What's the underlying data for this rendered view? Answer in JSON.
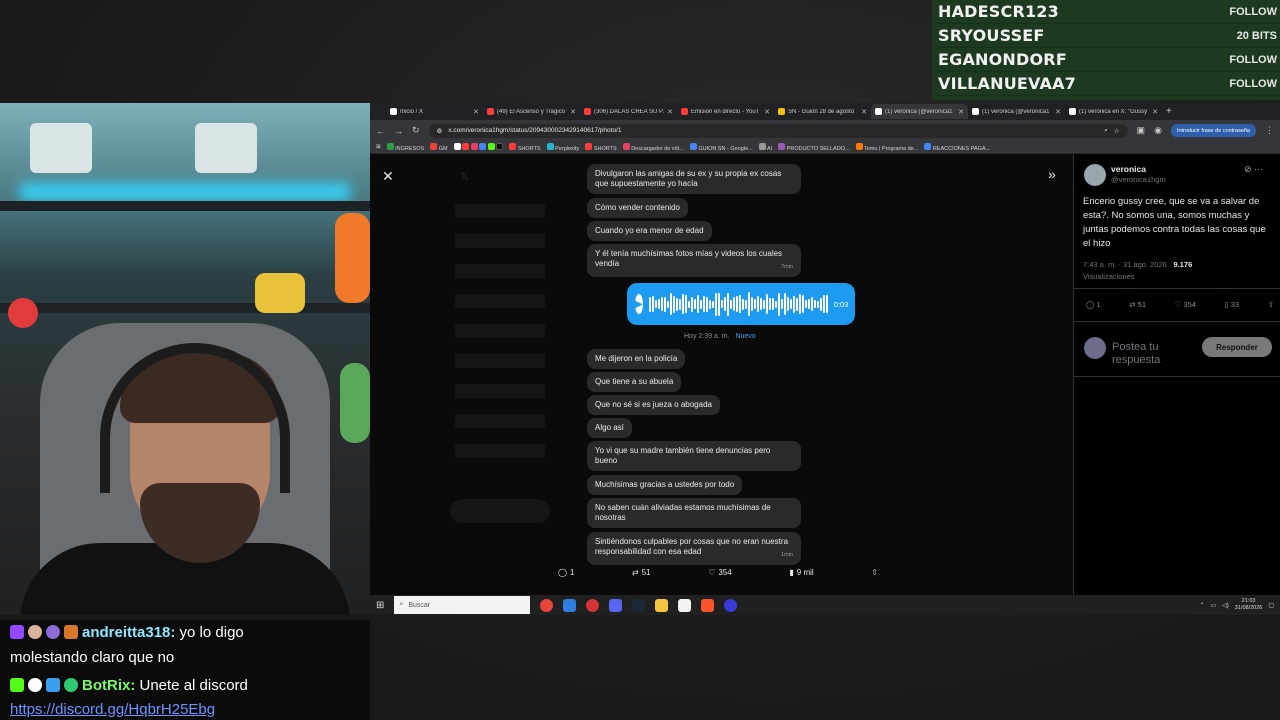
{
  "alerts": [
    {
      "name": "HADESCR123",
      "action": "FOLLOW"
    },
    {
      "name": "SRYOUSSEF",
      "action": "20 BITS"
    },
    {
      "name": "EGANONDORF",
      "action": "FOLLOW"
    },
    {
      "name": "VILLANUEVAA7",
      "action": "FOLLOW"
    }
  ],
  "browser": {
    "tabs": [
      {
        "title": "Inicio / X",
        "color": "#ffffff"
      },
      {
        "title": "(49) El Ascenso y Trágico",
        "color": "#ff3b3b"
      },
      {
        "title": "(306) DALAS CREA SU P...",
        "color": "#ff3b3b"
      },
      {
        "title": "Emisión en directo - YouT",
        "color": "#ff3b3b"
      },
      {
        "title": "SN - Guion 28 de agosto",
        "color": "#f4c20d"
      },
      {
        "title": "(1) veronica (@veronica1",
        "color": "#ffffff"
      },
      {
        "title": "(1) veronica (@veronica1",
        "color": "#ffffff"
      },
      {
        "title": "(1) veronica en X: \"Gussy",
        "color": "#ffffff"
      }
    ],
    "url": "x.com/veronica1hgm/status/2094300023429140617/photo/1",
    "password_pill": "Introducir frase de contraseña",
    "bookmarks": [
      {
        "label": "INGRESOS",
        "color": "#2ea043"
      },
      {
        "label": "GM",
        "color": "#ea4335"
      },
      {
        "label": "SHORTS",
        "color": "#ff3b3b"
      },
      {
        "label": "Perplexity",
        "color": "#20b8cd"
      },
      {
        "label": "SHORTS",
        "color": "#ff3b3b"
      },
      {
        "label": "Descargador de víd...",
        "color": "#e4405f"
      },
      {
        "label": "GUION SN - Google...",
        "color": "#4285f4"
      },
      {
        "label": "AI",
        "color": "#999999"
      },
      {
        "label": "PRODUCTO SELLADO...",
        "color": "#9b59b6"
      },
      {
        "label": "Temu | Programa de...",
        "color": "#ff7a00"
      },
      {
        "label": "REACCIONES PAGA...",
        "color": "#4285f4"
      }
    ]
  },
  "photo": {
    "messages_top": [
      {
        "text": "Divulgaron las amigas de su ex y su propia ex cosas que supuestamente yo hacía",
        "time": ""
      },
      {
        "text": "Cómo vender contenido",
        "time": ""
      },
      {
        "text": "Cuando yo era menor de edad",
        "time": ""
      },
      {
        "text": "Y él tenía muchísimas fotos mías y videos los cuales vendía",
        "time": "7min"
      }
    ],
    "voice_duration": "0:03",
    "divider_time": "Hoy 2:39 a. m.",
    "divider_new": "Nuevo",
    "messages_bottom": [
      {
        "text": "Me dijeron en la policía",
        "time": ""
      },
      {
        "text": "Que tiene a su abuela",
        "time": ""
      },
      {
        "text": "Que no sé si es jueza o abogada",
        "time": ""
      },
      {
        "text": "Algo así",
        "time": ""
      },
      {
        "text": "Yo vi que su madre también tiene denuncias pero bueno",
        "time": ""
      },
      {
        "text": "Muchísimas gracias a ustedes por todo",
        "time": ""
      },
      {
        "text": "No saben cuán aliviadas estamos muchísimas de nosotras",
        "time": ""
      },
      {
        "text": "Sintiéndonos culpables por cosas que no eran nuestra responsabilidad con esa edad",
        "time": "1min"
      }
    ],
    "actions": {
      "replies": "1",
      "reposts": "51",
      "likes": "354",
      "views": "9 mil"
    }
  },
  "tweet": {
    "name": "veronica",
    "handle": "@veronica1hgm",
    "text": "Encerio gussy cree, que se va a salvar de esta?. No somos una, somos muchas y juntas podemos contra todas las cosas que el hizo",
    "meta": "7:43 a. m. · 31 ago. 2026 · ",
    "views_count": "9.176",
    "views_label": "Visualizaciones",
    "replies": "1",
    "reposts": "51",
    "likes": "354",
    "bookmarks": "33",
    "reply_placeholder": "Postea tu respuesta",
    "reply_button": "Responder"
  },
  "taskbar": {
    "search_label": "Buscar",
    "time": "21:03",
    "date": "31/08/2026"
  },
  "chat": {
    "line1_user": "andreitta318:",
    "line1_text": " yo lo digo",
    "line1_cont": "molestando claro que no",
    "line2_user": "BotRix:",
    "line2_text": " Unete al discord",
    "line2_link": "https://discord.gg/HqbrH25Ebg"
  },
  "colors": {
    "x_blue": "#1d9bf0",
    "alert_bg": "#1d3a21"
  }
}
